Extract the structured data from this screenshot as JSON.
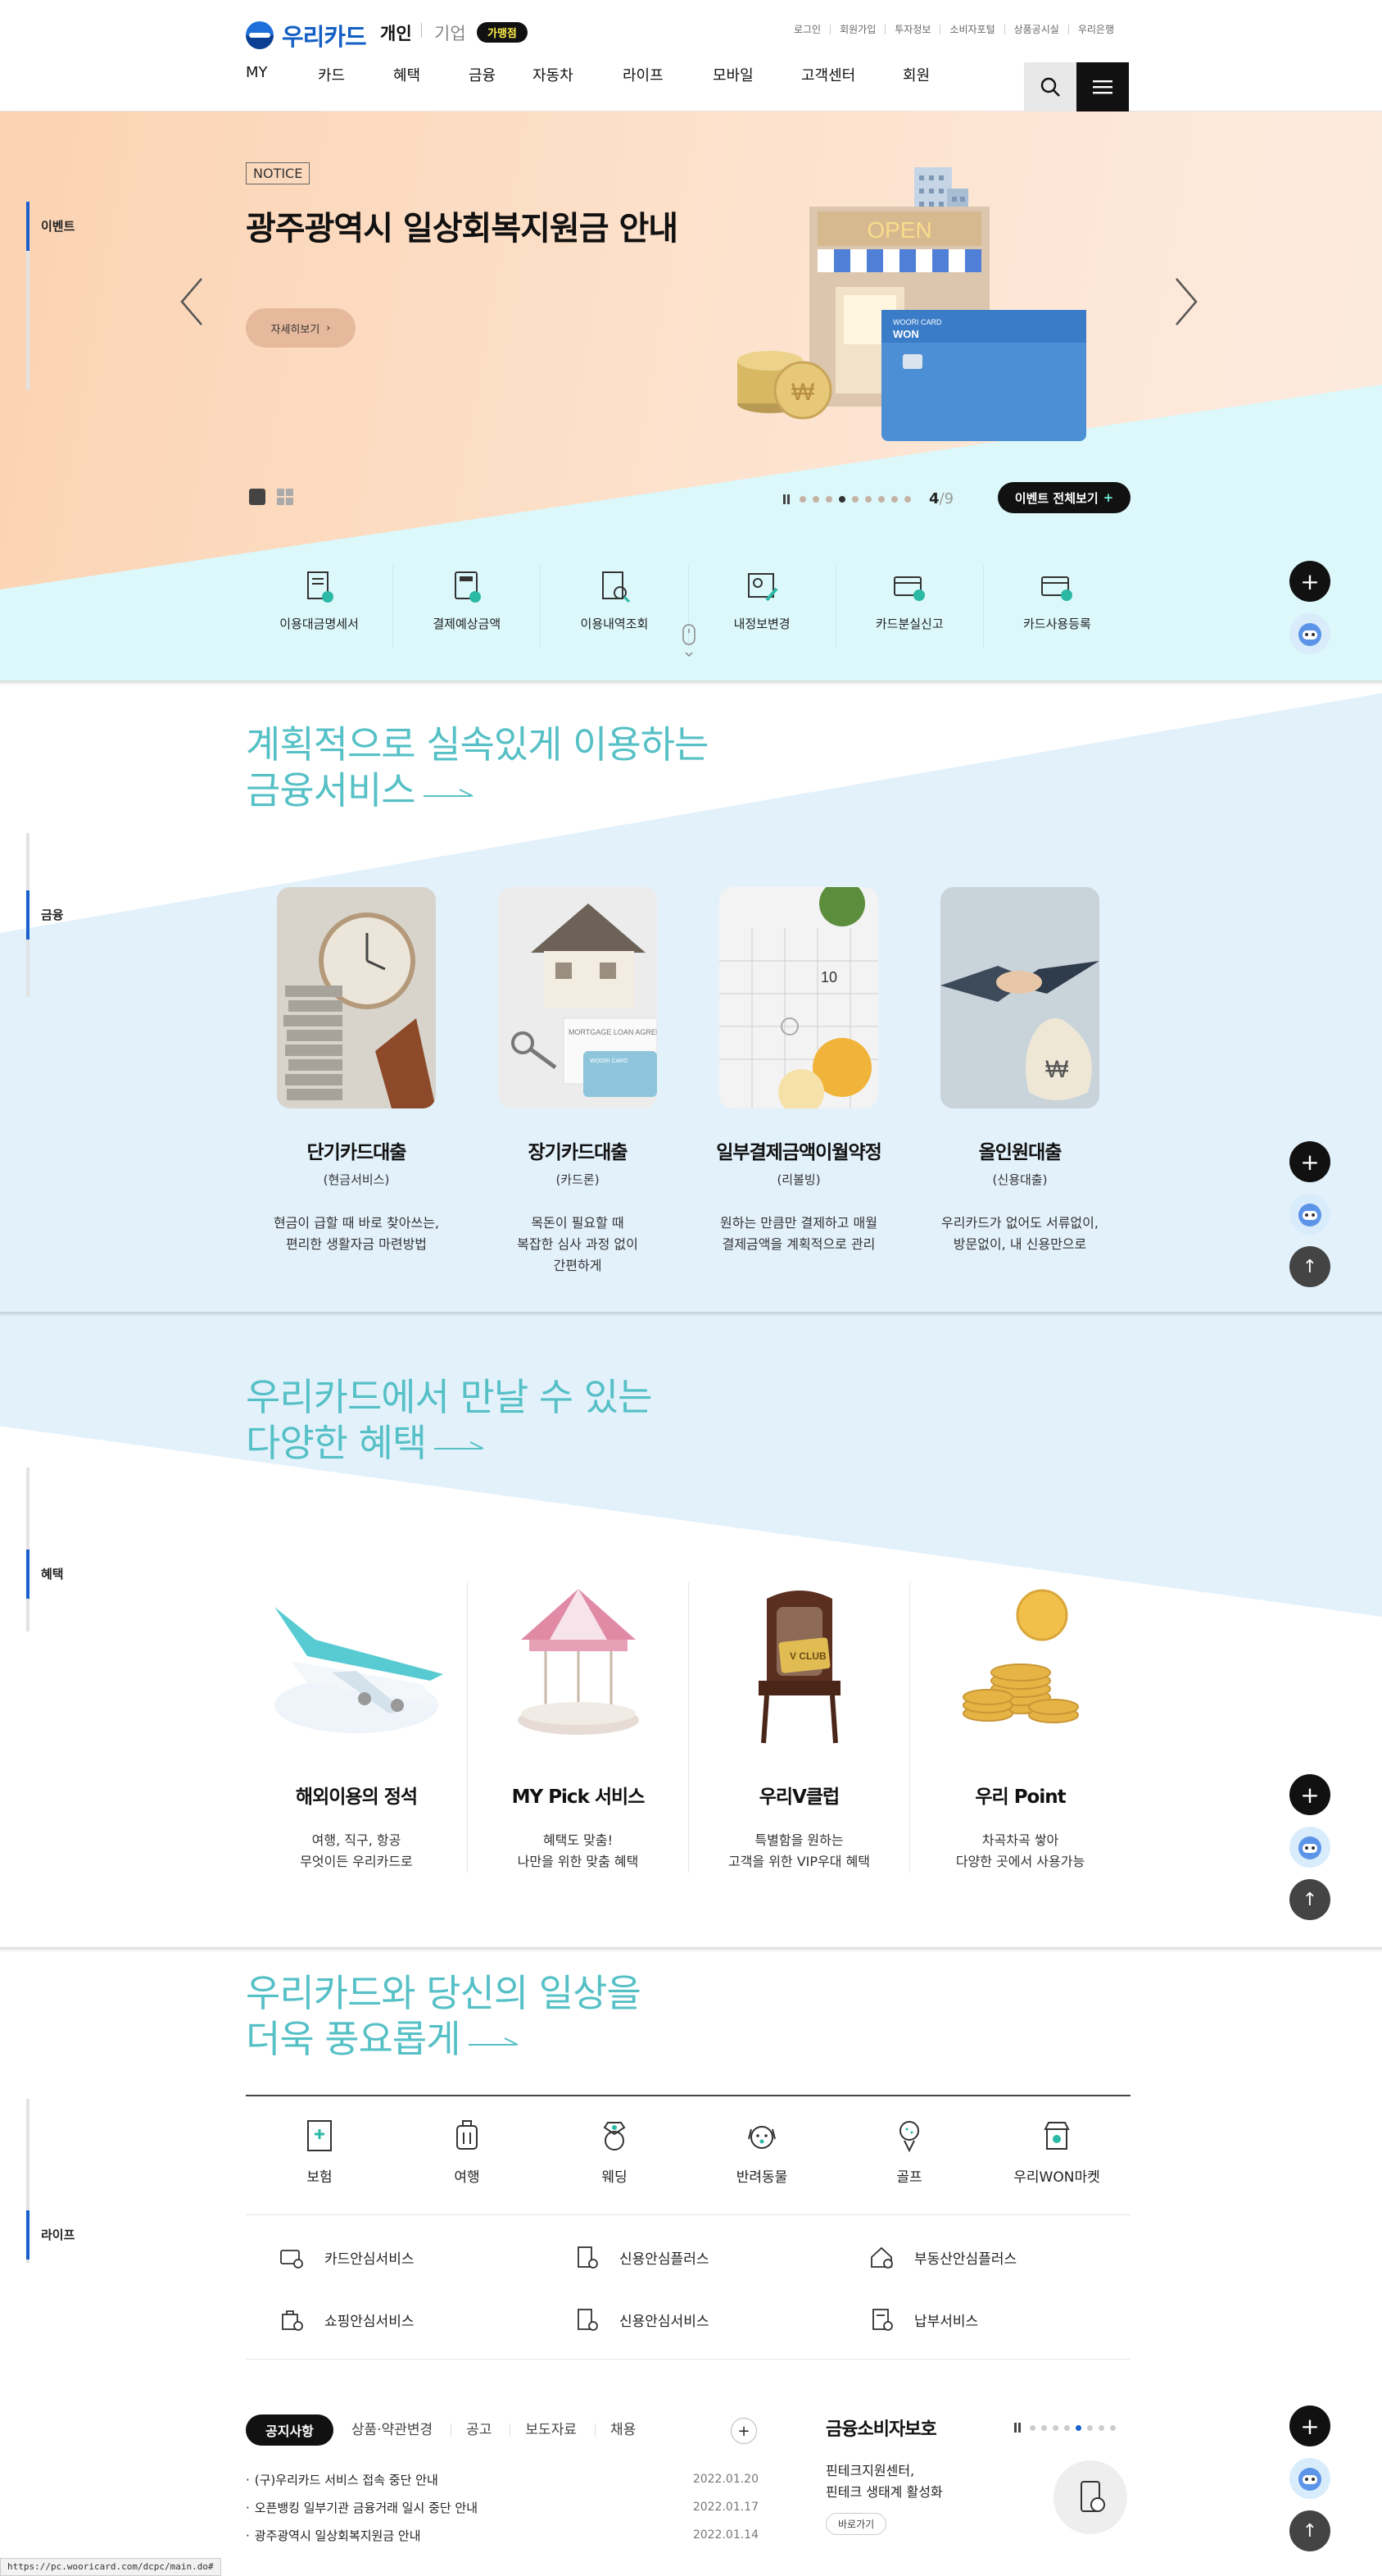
{
  "header": {
    "logo": "우리카드",
    "segment_personal": "개인",
    "segment_corporate": "기업",
    "affiliate_badge": "가맹점",
    "util_links": [
      "로그인",
      "회원가입",
      "투자정보",
      "소비자포털",
      "상품공시실",
      "우리은행"
    ],
    "gnb": [
      "MY",
      "카드",
      "혜택",
      "금융",
      "자동차",
      "라이프",
      "모바일",
      "고객센터",
      "회원"
    ]
  },
  "hero": {
    "side_label": "이벤트",
    "notice_tag": "NOTICE",
    "title": "광주광역시 일상회복지원금 안내",
    "more_label": "자세히보기",
    "page_current": "4",
    "page_total": "9",
    "page_sep": "/",
    "event_all_label": "이벤트 전체보기",
    "illustration_texts": {
      "store_sign": "OPEN",
      "card_brand": "WOORI CARD",
      "card_logo": "WON"
    },
    "quick_menu": [
      "이용대금명세서",
      "결제예상금액",
      "이용내역조회",
      "내정보변경",
      "카드분실신고",
      "카드사용등록"
    ]
  },
  "finance": {
    "side_label": "금융",
    "heading_line1": "계획적으로 실속있게 이용하는",
    "heading_line2": "금융서비스",
    "cards": [
      {
        "title": "단기카드대출",
        "sub": "(현금서비스)",
        "desc": "현금이 급할 때 바로 찾아쓰는,\n편리한 생활자금 마련방법"
      },
      {
        "title": "장기카드대출",
        "sub": "(카드론)",
        "desc": "목돈이 필요할 때\n복잡한 심사 과정 없이\n간편하게"
      },
      {
        "title": "일부결제금액이월약정",
        "sub": "(리볼빙)",
        "desc": "원하는 만큼만 결제하고 매월\n결제금액을 계획적으로 관리"
      },
      {
        "title": "올인원대출",
        "sub": "(신용대출)",
        "desc": "우리카드가 없어도 서류없이,\n방문없이, 내 신용만으로"
      }
    ],
    "image_texts": {
      "mortgage": "MORTGAGE LOAN AGREEMENT",
      "calendar_day": "10",
      "card_brand": "WOORI CARD"
    }
  },
  "benefits": {
    "side_label": "혜택",
    "heading_line1": "우리카드에서 만날 수 있는",
    "heading_line2": "다양한 혜택",
    "cards": [
      {
        "title": "해외이용의 정석",
        "desc": "여행, 직구, 항공\n무엇이든 우리카드로"
      },
      {
        "title": "MY Pick 서비스",
        "desc": "혜택도 맞춤!\n나만을 위한 맞춤 혜택"
      },
      {
        "title": "우리V클럽",
        "desc": "특별함을 원하는\n고객을 위한 VIP우대 혜택"
      },
      {
        "title": "우리 Point",
        "desc": "차곡차곡 쌓아\n다양한 곳에서 사용가능"
      }
    ],
    "image_texts": {
      "vclub": "V CLUB"
    }
  },
  "life": {
    "side_label": "라이프",
    "heading_line1": "우리카드와 당신의 일상을",
    "heading_line2": "더욱 풍요롭게",
    "categories": [
      {
        "label": "보험",
        "icon": "insurance-icon"
      },
      {
        "label": "여행",
        "icon": "luggage-icon"
      },
      {
        "label": "웨딩",
        "icon": "ring-icon"
      },
      {
        "label": "반려동물",
        "icon": "dog-icon"
      },
      {
        "label": "골프",
        "icon": "golf-icon"
      },
      {
        "label": "우리WON마켓",
        "icon": "market-icon"
      }
    ],
    "services": [
      "카드안심서비스",
      "신용안심플러스",
      "부동산안심플러스",
      "쇼핑안심서비스",
      "신용안심서비스",
      "납부서비스"
    ]
  },
  "notices": {
    "tab_active": "공지사항",
    "tabs": [
      "상품·약관변경",
      "공고",
      "보도자료",
      "채용"
    ],
    "items": [
      {
        "title": "(구)우리카드 서비스 접속 중단 안내",
        "date": "2022.01.20"
      },
      {
        "title": "오픈뱅킹 일부기관 금융거래 일시 중단 안내",
        "date": "2022.01.17"
      },
      {
        "title": "광주광역시 일상회복지원금 안내",
        "date": "2022.01.14"
      }
    ]
  },
  "consumer": {
    "title": "금융소비자보호",
    "text": "핀테크지원센터,\n핀테크 생태계 활성화",
    "button": "바로가기"
  },
  "status_url": "https://pc.wooricard.com/dcpc/main.do#",
  "colors": {
    "brand_blue": "#135fc4",
    "teal_heading": "#55c0c6",
    "accent_mint": "#6ef0d8"
  }
}
